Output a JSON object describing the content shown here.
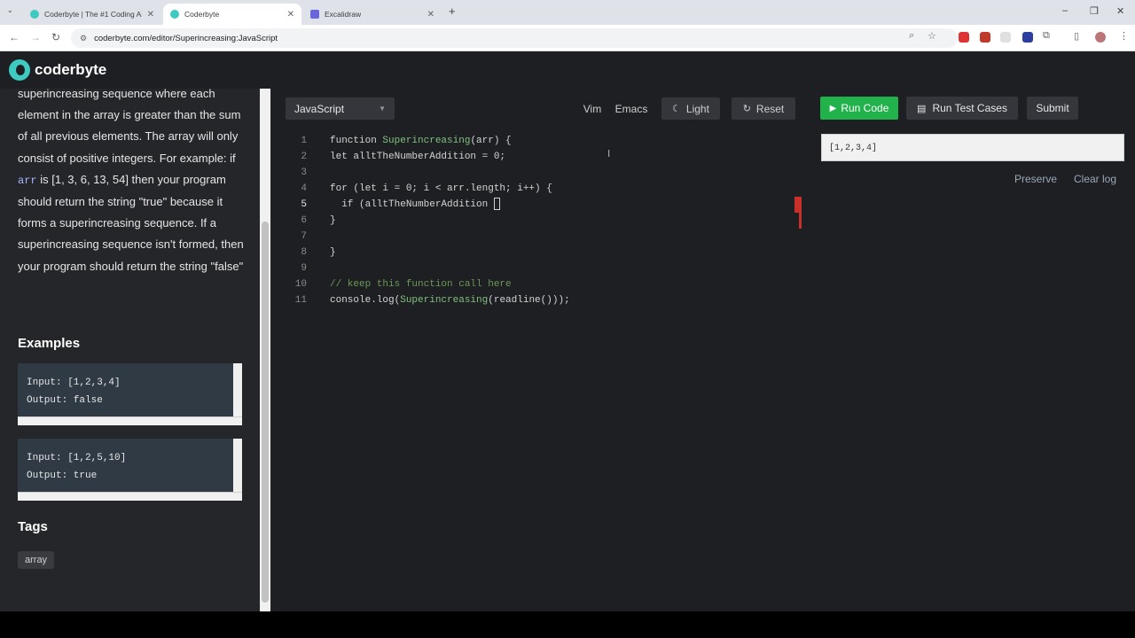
{
  "browser": {
    "tabs": [
      {
        "label": "Coderbyte | The #1 Coding Ass",
        "favicon_color": "#3ec9c1"
      },
      {
        "label": "Coderbyte",
        "favicon_color": "#3ec9c1"
      },
      {
        "label": "Excalidraw",
        "favicon_color": "#6965db"
      }
    ],
    "url": "coderbyte.com/editor/Superincreasing:JavaScript"
  },
  "site": {
    "logo_text": "coderbyte"
  },
  "problem": {
    "description_parts": [
      "superincreasing sequence where each element in the array is greater than the sum of all previous elements. The array will only consist of positive integers. For example: if ",
      "arr",
      " is [1, 3, 6, 13, 54] then your program should return the string \"true\" because it forms a superincreasing sequence. If a superincreasing sequence isn't formed, then your program should return the string \"false\""
    ],
    "examples_title": "Examples",
    "examples": [
      {
        "input": "Input: [1,2,3,4]",
        "output": "Output: false"
      },
      {
        "input": "Input: [1,2,5,10]",
        "output": "Output: true"
      }
    ],
    "tags_title": "Tags",
    "tags": [
      "array"
    ]
  },
  "editor": {
    "language": "JavaScript",
    "vim_label": "Vim",
    "emacs_label": "Emacs",
    "light_label": "Light",
    "reset_label": "Reset",
    "current_line": 5,
    "lines": [
      {
        "n": "1",
        "pre": "function ",
        "fn": "Superincreasing",
        "post": "(arr) {"
      },
      {
        "n": "2",
        "pre": "let alltTheNumberAddition = 0;"
      },
      {
        "n": "3",
        "pre": ""
      },
      {
        "n": "4",
        "pre": "for (let i = 0; i < arr.length; i++) {"
      },
      {
        "n": "5",
        "pre": "  if (alltTheNumberAddition "
      },
      {
        "n": "6",
        "pre": "}"
      },
      {
        "n": "7",
        "pre": ""
      },
      {
        "n": "8",
        "pre": "}"
      },
      {
        "n": "9",
        "pre": ""
      },
      {
        "n": "10",
        "comment": "// keep this function call here"
      },
      {
        "n": "11",
        "pre": "console.log(",
        "fn": "Superincreasing",
        "post": "(readline()));"
      }
    ]
  },
  "run_panel": {
    "run_label": "Run Code",
    "test_label": "Run Test Cases",
    "submit_label": "Submit",
    "input_value": "[1,2,3,4]",
    "preserve_label": "Preserve",
    "clear_label": "Clear log"
  },
  "colors": {
    "accent": "#21b24b",
    "brand": "#3ec9c1"
  }
}
